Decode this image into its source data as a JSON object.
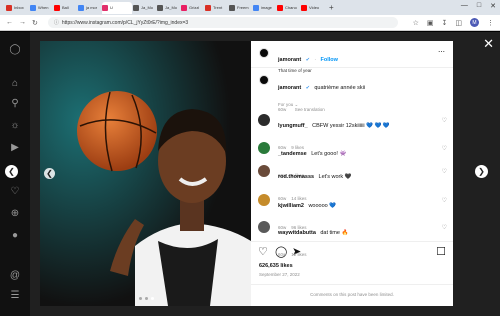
{
  "browser": {
    "tabs": [
      {
        "label": "Inbox",
        "color": "#d93025"
      },
      {
        "label": "When",
        "color": "#4285f4"
      },
      {
        "label": "Ball",
        "color": "#ff0000"
      },
      {
        "label": "ja mor",
        "color": "#4285f4"
      },
      {
        "label": "U",
        "color": "#e1306c",
        "active": true
      },
      {
        "label": "Ja_Mo",
        "color": "#555"
      },
      {
        "label": "Ja_Mo",
        "color": "#555"
      },
      {
        "label": "Grizzl",
        "color": "#e91e63"
      },
      {
        "label": "Trent",
        "color": "#d93025"
      },
      {
        "label": "Freem",
        "color": "#555"
      },
      {
        "label": "image",
        "color": "#4285f4"
      },
      {
        "label": "Chano",
        "color": "#ff0000"
      },
      {
        "label": "Video",
        "color": "#ff0000"
      }
    ],
    "window_controls": {
      "minimize": "—",
      "maximize": "□",
      "close": "✕"
    },
    "url": "https://www.instagram.com/p/CL_jYyZt0rE/?img_index=3",
    "avatar_letter": "M"
  },
  "post": {
    "author": "jamorant",
    "follow_label": "Follow",
    "subtitle": "That time of year",
    "caption_user": "jamorant",
    "caption_text": "quatrième année skii",
    "caption_time": "60w",
    "see_translation": "See translation",
    "for_you": "For you",
    "comments": [
      {
        "user": "lyungmuff_",
        "text": "CBFW yessir 12skiiiiii 💙 💙 💙",
        "time": "60w",
        "likes": "9 likes",
        "avatar_color": "#2b2b2b"
      },
      {
        "user": "_tandemse",
        "text": "Let's gooo! 👾",
        "time": "60w",
        "likes": "6 likes",
        "avatar_color": "#2a7a3a"
      },
      {
        "user": "rod.thomasss",
        "text": "Let's work 🖤",
        "time": "60w",
        "likes": "14 likes",
        "avatar_color": "#6a4b3a"
      },
      {
        "user": "kjwilliam2",
        "text": "wooooo 💙",
        "time": "60w",
        "likes": "96 likes",
        "avatar_color": "#c58b2a"
      },
      {
        "user": "waywitdabutta",
        "text": "dat time 🔥",
        "time": "60w",
        "likes": "12 likes",
        "avatar_color": "#5a5a5a"
      }
    ],
    "likes": "626,635 likes",
    "date": "September 27, 2022",
    "comments_limited": "Comments on this post have been limited."
  }
}
